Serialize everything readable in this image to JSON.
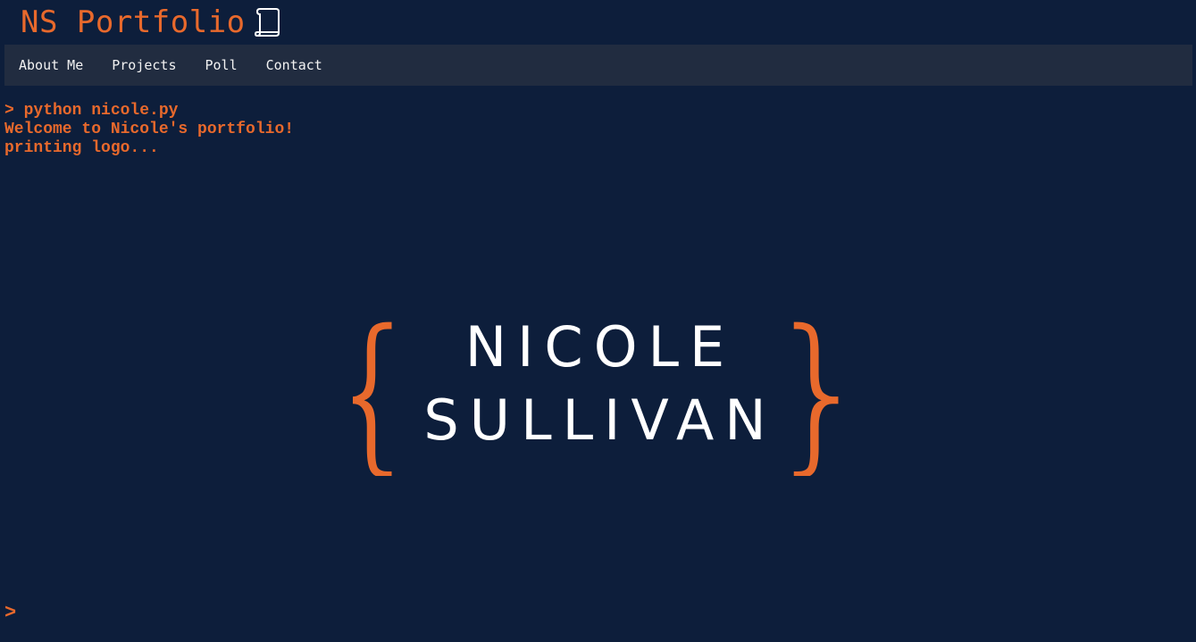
{
  "header": {
    "title": "NS Portfolio",
    "icon": "scroll-icon"
  },
  "nav": {
    "items": [
      {
        "label": "About Me"
      },
      {
        "label": "Projects"
      },
      {
        "label": "Poll"
      },
      {
        "label": "Contact"
      }
    ]
  },
  "terminal": {
    "lines": [
      "> python nicole.py",
      "Welcome to Nicole's portfolio!",
      "printing logo..."
    ],
    "prompt": ">"
  },
  "logo": {
    "line1": "NICOLE",
    "line2": "SULLIVAN",
    "bracket_left": "{",
    "bracket_right": "}"
  },
  "colors": {
    "background": "#0d1e3b",
    "nav_background": "#212c40",
    "accent": "#e8692c",
    "text_light": "#f2f2f2"
  }
}
